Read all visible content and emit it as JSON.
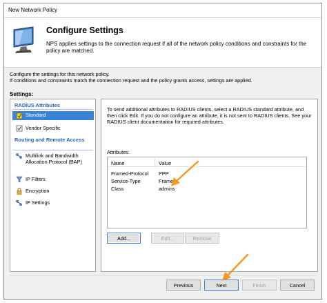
{
  "window": {
    "title": "New Network Policy"
  },
  "header": {
    "title": "Configure Settings",
    "description": "NPS applies settings to the connection request if all of the network policy conditions and constraints for the policy are matched."
  },
  "intro": {
    "line1": "Configure the settings for this network policy.",
    "line2": "If conditions and constraints match the connection request and the policy grants access, settings are applied."
  },
  "settings_label": "Settings:",
  "sidebar": {
    "group1": "RADIUS Attributes",
    "item_standard": "Standard",
    "item_vendor": "Vendor Specific",
    "group2": "Routing and Remote Access",
    "item_multilink": "Multilink and Bandwidth Allocation Protocol (BAP)",
    "item_ipfilters": "IP Filters",
    "item_encryption": "Encryption",
    "item_ipsettings": "IP Settings"
  },
  "content": {
    "description": "To send additional attributes to RADIUS clients, select a RADIUS standard attribute, and then click Edit. If you do not configure an attribute, it is not sent to RADIUS clients. See your RADIUS client documentation for required attributes.",
    "attributes_label": "Attributes:",
    "columns": {
      "name": "Name",
      "value": "Value"
    },
    "rows": [
      {
        "name": "Framed-Protocol",
        "value": "PPP"
      },
      {
        "name": "Service-Type",
        "value": "Framed"
      },
      {
        "name": "Class",
        "value": "admins"
      }
    ],
    "buttons": {
      "add": "Add...",
      "edit": "Edit...",
      "remove": "Remove"
    }
  },
  "footer": {
    "previous": "Previous",
    "next": "Next",
    "finish": "Finish",
    "cancel": "Cancel"
  },
  "colors": {
    "accent": "#3a83d6",
    "group_heading": "#2b64c0",
    "annotation_arrow": "#f39a1e"
  }
}
